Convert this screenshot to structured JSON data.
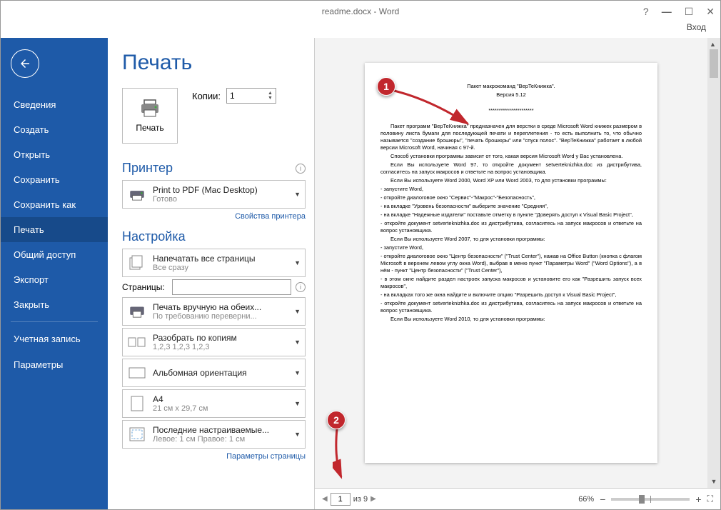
{
  "window": {
    "title": "readme.docx - Word",
    "login": "Вход"
  },
  "sidebar": {
    "items": [
      {
        "label": "Сведения"
      },
      {
        "label": "Создать"
      },
      {
        "label": "Открыть"
      },
      {
        "label": "Сохранить"
      },
      {
        "label": "Сохранить как"
      },
      {
        "label": "Печать"
      },
      {
        "label": "Общий доступ"
      },
      {
        "label": "Экспорт"
      },
      {
        "label": "Закрыть"
      }
    ],
    "bottom": [
      {
        "label": "Учетная запись"
      },
      {
        "label": "Параметры"
      }
    ],
    "active_index": 5
  },
  "print": {
    "heading": "Печать",
    "print_button": "Печать",
    "copies_label": "Копии:",
    "copies_value": "1",
    "printer_heading": "Принтер",
    "printer": {
      "name": "Print to PDF (Mac Desktop)",
      "status": "Готово"
    },
    "printer_props": "Свойства принтера",
    "settings_heading": "Настройка",
    "setting_pages": {
      "l1": "Напечатать все страницы",
      "l2": "Все сразу"
    },
    "pages_label": "Страницы:",
    "pages_value": "",
    "setting_duplex": {
      "l1": "Печать вручную на обеих...",
      "l2": "По требованию переверни..."
    },
    "setting_collate": {
      "l1": "Разобрать по копиям",
      "l2": "1,2,3   1,2,3   1,2,3"
    },
    "setting_orient": {
      "l1": "Альбомная ориентация",
      "l2": ""
    },
    "setting_paper": {
      "l1": "A4",
      "l2": "21 см x 29,7 см"
    },
    "setting_margins": {
      "l1": "Последние настраиваемые...",
      "l2": "Левое: 1 см   Правое: 1 см"
    },
    "page_setup": "Параметры страницы"
  },
  "preview": {
    "page_current": "1",
    "page_total": "из 9",
    "zoom": "66%",
    "doc": {
      "title": "Пакет макрокоманд \"ВерТеКнижка\".",
      "version": "Версия 5.12",
      "sep": "**********************",
      "p1": "Пакет программ \"ВерТеКнижка\" предназначен для верстки в среде Microsoft Word книжек размером в половину листа бумаги для последующей печати и переплетения - то есть выполнить то, что обычно называется \"создание брошюры\", \"печать брошюры\" или \"спуск полос\". \"ВерТеКнижка\" работает в любой версии Microsoft Word, начиная с 97-й.",
      "p2": "Способ установки программы зависит от того, какая версия Microsoft Word у Вас установлена.",
      "p3": "Если Вы используете Word 97, то откройте документ setverteknizhka.doc из дистрибутива, согласитесь на запуск макросов и ответьте на вопрос установщика.",
      "p4": "Если Вы используете Word 2000, Word XP или Word 2003, то для установки программы:",
      "b1": "- запустите Word,",
      "b2": "- откройте диалоговое окно \"Сервис\"-\"Макрос\"-\"Безопасность\",",
      "b3": "- на вкладке \"Уровень безопасности\" выберите значение \"Средняя\",",
      "b4": "- на вкладке \"Надежные издатели\" поставьте отметку в пункте \"Доверять доступ к Visual Basic Project\",",
      "b5": "- откройте документ setverteknizhka.doc из дистрибутива, согласитесь на запуск макросов и ответьте на вопрос установщика.",
      "p5": "Если Вы используете Word 2007, то для установки программы:",
      "c1": "- запустите Word,",
      "c2": "- откройте диалоговое окно \"Центр безопасности\" (\"Trust Center\"), нажав на Office Button (кнопка с флагом Microsoft в верхнем левом углу окна Word), выбрав в меню пункт \"Параметры Word\" (\"Word Options\"), а в нём - пункт \"Центр безопасности\" (\"Trust Center\"),",
      "c3": "- в этом окне найдите раздел настроек запуска макросов и установите его как \"Разрешить запуск всех макросов\",",
      "c4": "- на вкладках того же окна найдите и включите опцию \"Разрешить доступ к Visual Basic Project\",",
      "c5": "- откройте документ setverteknizhka.doc из дистрибутива, согласитесь на запуск макросов и ответьте на вопрос установщика.",
      "p6": "Если Вы используете Word 2010, то для установки программы:"
    }
  },
  "annotations": {
    "a1": "1",
    "a2": "2"
  }
}
